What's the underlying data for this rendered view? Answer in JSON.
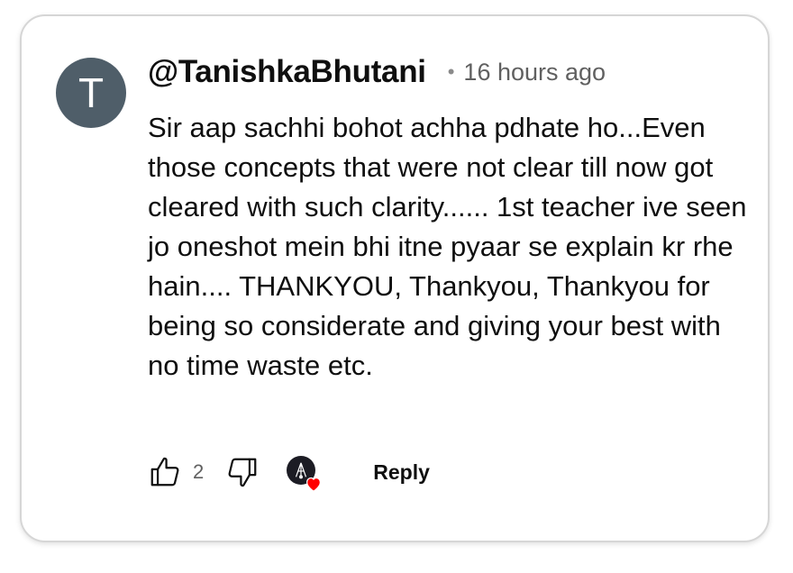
{
  "comment": {
    "avatar_letter": "T",
    "avatar_color": "#4f5e69",
    "username": "@TanishkaBhutani",
    "separator": "•",
    "timestamp": "16 hours ago",
    "text": "Sir aap sachhi bohot achha pdhate ho...Even those concepts that were not clear till now got cleared with such clarity...... 1st teacher ive seen jo oneshot mein bhi itne pyaar se explain kr rhe hain.... THANKYOU, Thankyou, Thankyou for being so considerate and giving your best with no time waste etc."
  },
  "actions": {
    "like_icon": "thumbs-up-icon",
    "like_count": "2",
    "dislike_icon": "thumbs-down-icon",
    "creator_heart_icon": "creator-heart-icon",
    "heart_color": "#ff0000",
    "reply_label": "Reply"
  }
}
